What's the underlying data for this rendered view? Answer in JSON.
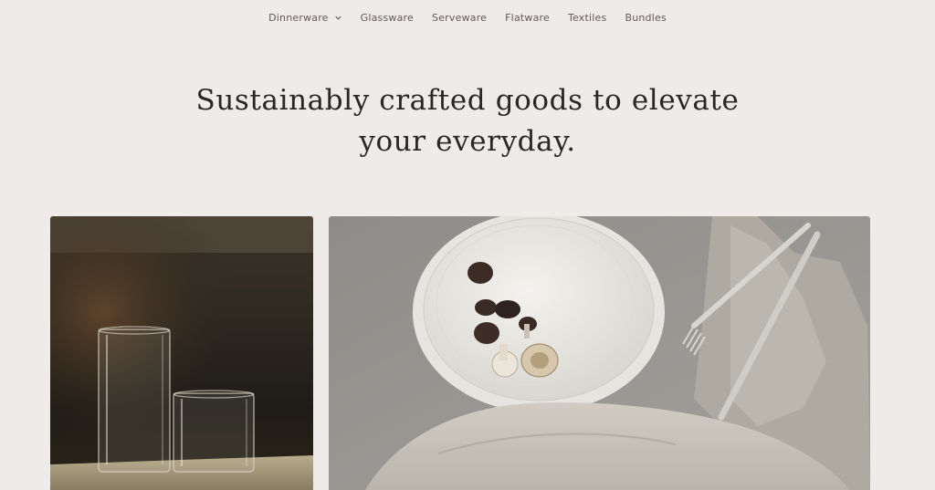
{
  "nav": {
    "items": [
      {
        "label": "Dinnerware",
        "has_dropdown": true
      },
      {
        "label": "Glassware",
        "has_dropdown": false
      },
      {
        "label": "Serveware",
        "has_dropdown": false
      },
      {
        "label": "Flatware",
        "has_dropdown": false
      },
      {
        "label": "Textiles",
        "has_dropdown": false
      },
      {
        "label": "Bundles",
        "has_dropdown": false
      }
    ],
    "dropdown_icon": "chevron-down-icon"
  },
  "hero": {
    "line1": "Sustainably crafted goods to elevate",
    "line2": "your everyday."
  },
  "images": {
    "left_alt": "Two clear drinking glasses on a table",
    "right_alt": "Ceramic plates with mushrooms, linen napkin and cutlery"
  },
  "colors": {
    "background": "#efebe9",
    "text": "#2a2726",
    "nav_text": "#5f5a56"
  }
}
